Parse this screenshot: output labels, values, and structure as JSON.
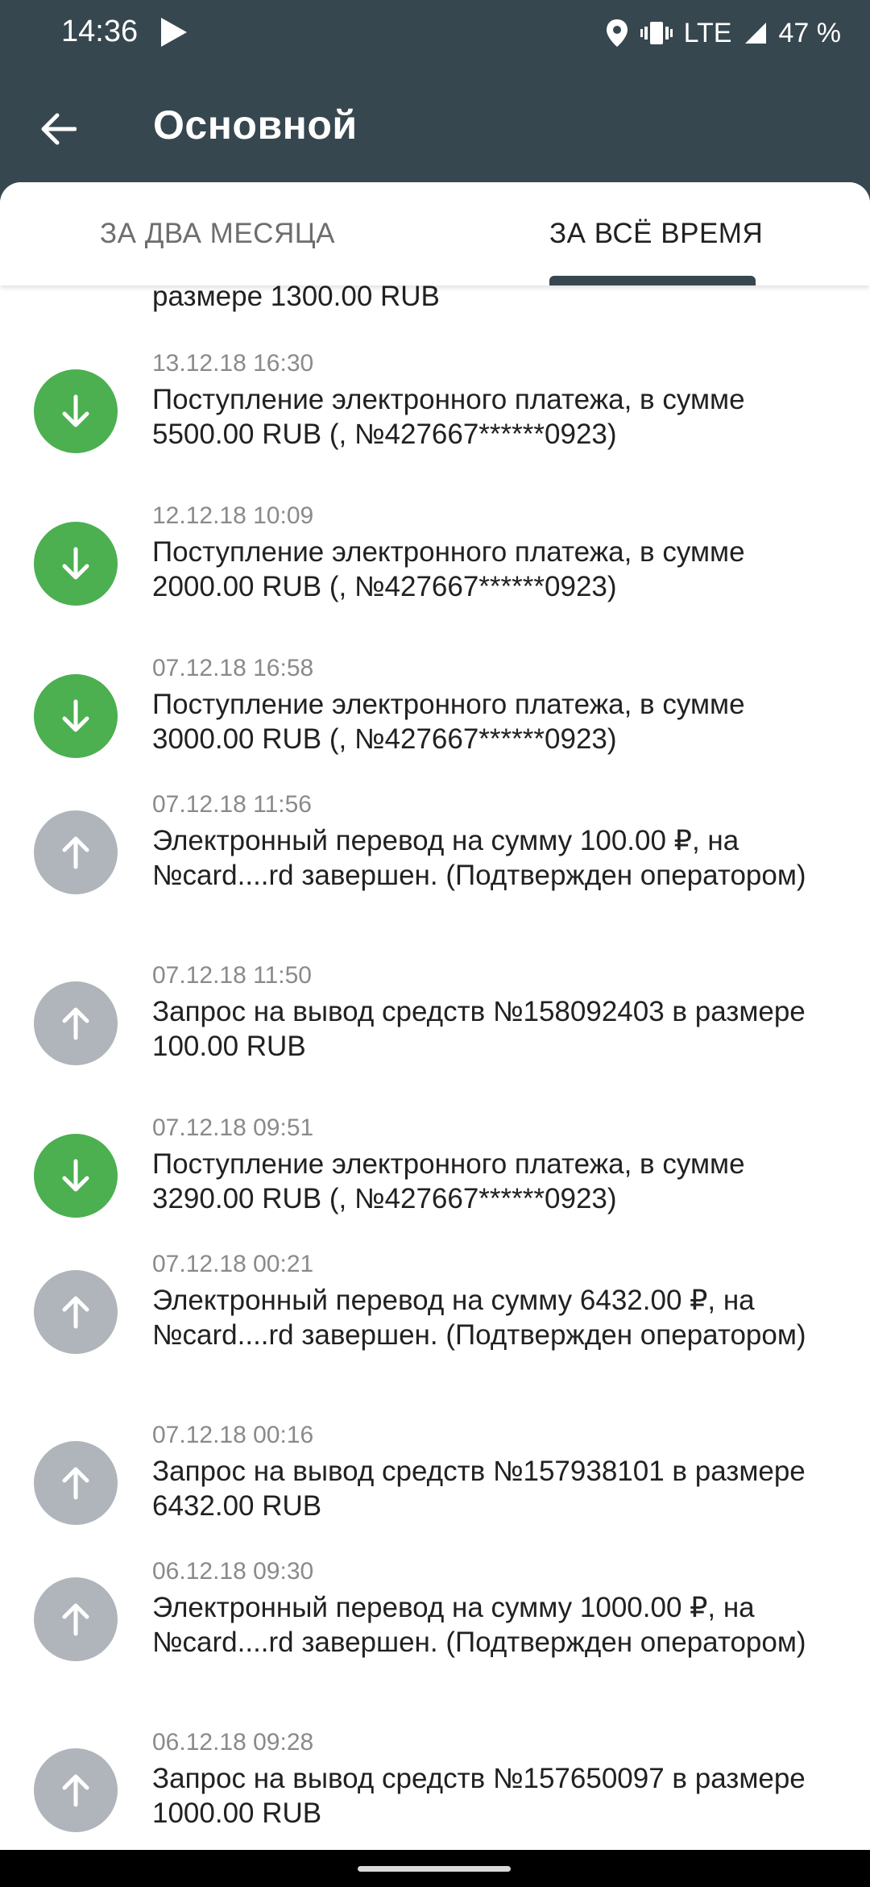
{
  "status_bar": {
    "time": "14:36",
    "network": "LTE",
    "battery": "47 %"
  },
  "app_bar": {
    "title": "Основной"
  },
  "tabs": [
    {
      "label": "ЗА ДВА МЕСЯЦА",
      "active": false
    },
    {
      "label": "ЗА ВСЁ ВРЕМЯ",
      "active": true
    }
  ],
  "partial_item": {
    "desc_line": "размере 1300.00 RUB"
  },
  "transactions": [
    {
      "timestamp": "13.12.18 16:30",
      "direction": "in",
      "icon": "arrow-down-icon",
      "description": "Поступление электронного платежа, в сумме 5500.00 RUB (,  №427667******0923)"
    },
    {
      "timestamp": "12.12.18 10:09",
      "direction": "in",
      "icon": "arrow-down-icon",
      "description": "Поступление электронного платежа, в сумме 2000.00 RUB (,  №427667******0923)"
    },
    {
      "timestamp": "07.12.18 16:58",
      "direction": "in",
      "icon": "arrow-down-icon",
      "description": "Поступление электронного платежа, в сумме 3000.00 RUB (,  №427667******0923)"
    },
    {
      "timestamp": "07.12.18 11:56",
      "direction": "out",
      "icon": "arrow-up-icon",
      "description": "Электронный перевод на сумму 100.00 ₽, на №card....rd завершен. (Подтвержден оператором)"
    },
    {
      "timestamp": "07.12.18 11:50",
      "direction": "out",
      "icon": "arrow-up-icon",
      "description": "Запрос на вывод средств №158092403 в размере 100.00 RUB"
    },
    {
      "timestamp": "07.12.18 09:51",
      "direction": "in",
      "icon": "arrow-down-icon",
      "description": "Поступление электронного платежа, в сумме 3290.00 RUB (,  №427667******0923)"
    },
    {
      "timestamp": "07.12.18 00:21",
      "direction": "out",
      "icon": "arrow-up-icon",
      "description": "Электронный перевод на сумму 6432.00 ₽, на №card....rd завершен. (Подтвержден оператором)"
    },
    {
      "timestamp": "07.12.18 00:16",
      "direction": "out",
      "icon": "arrow-up-icon",
      "description": "Запрос на вывод средств №157938101 в размере 6432.00 RUB"
    },
    {
      "timestamp": "06.12.18 09:30",
      "direction": "out",
      "icon": "arrow-up-icon",
      "description": "Электронный перевод на сумму 1000.00 ₽, на №card....rd завершен. (Подтвержден оператором)"
    },
    {
      "timestamp": "06.12.18 09:28",
      "direction": "out",
      "icon": "arrow-up-icon",
      "description": "Запрос на вывод средств №157650097 в размере 1000.00 RUB"
    }
  ],
  "colors": {
    "app_bar": "#37474f",
    "incoming": "#4caf50",
    "outgoing": "#b0b4bb"
  }
}
